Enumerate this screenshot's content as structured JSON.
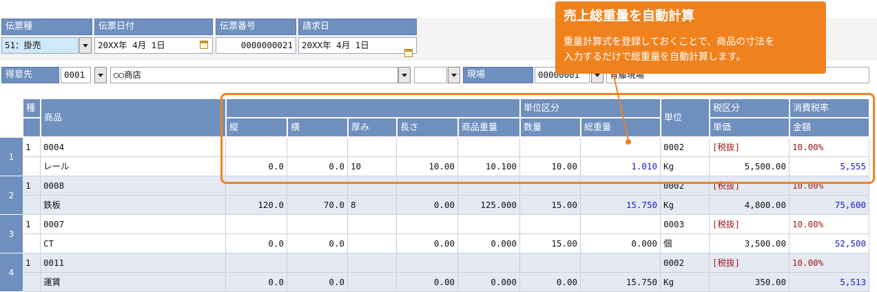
{
  "header": {
    "slip_type": {
      "label": "伝票種",
      "value": "51：掛売"
    },
    "slip_date": {
      "label": "伝票日付",
      "value": "20XX年  4月  1日"
    },
    "slip_no": {
      "label": "伝票番号",
      "value": "0000000021"
    },
    "billing_date": {
      "label": "請求日",
      "value": "20XX年  4月  1日"
    }
  },
  "customer": {
    "label": "得意先",
    "code": "0001",
    "name": "○○商店"
  },
  "site": {
    "label": "現場",
    "code": "00000001",
    "name": "青藤現場"
  },
  "table": {
    "h_type": "種",
    "h_product": "商品",
    "h_unit_group": "単位区分",
    "h_unit": "単位",
    "h_tax_class": "税区分",
    "h_tax_rate": "消費税率",
    "h_length": "縦",
    "h_width": "横",
    "h_thick": "厚み",
    "h_long": "長さ",
    "h_weight": "商品重量",
    "h_qty": "数量",
    "h_total_weight": "総重量",
    "h_price": "単価",
    "h_amount": "金額",
    "rows": [
      {
        "no": "1",
        "type": "1",
        "code": "0004",
        "name": "レール",
        "tate": "0.0",
        "yoko": "0.0",
        "thick": "10",
        "long": "10.00",
        "weight": "10.100",
        "qty": "10.00",
        "total": "1.010",
        "unit_code": "0002",
        "unit": "Kg",
        "tax": "[税抜]",
        "rate": "10.00%",
        "price": "5,500.00",
        "amount": "5,555"
      },
      {
        "no": "2",
        "type": "1",
        "code": "0008",
        "name": "鉄板",
        "tate": "120.0",
        "yoko": "70.0",
        "thick": "8",
        "long": "0.00",
        "weight": "125.000",
        "qty": "15.00",
        "total": "15.750",
        "unit_code": "0002",
        "unit": "Kg",
        "tax": "[税抜]",
        "rate": "10.00%",
        "price": "4,800.00",
        "amount": "75,600"
      },
      {
        "no": "3",
        "type": "1",
        "code": "0007",
        "name": "CT",
        "tate": "0.0",
        "yoko": "0.0",
        "thick": "",
        "long": "0.00",
        "weight": "0.000",
        "qty": "15.00",
        "total": "0.000",
        "unit_code": "0003",
        "unit": "個",
        "tax": "[税抜]",
        "rate": "10.00%",
        "price": "3,500.00",
        "amount": "52,500"
      },
      {
        "no": "4",
        "type": "1",
        "code": "0011",
        "name": "運賃",
        "tate": "0.0",
        "yoko": "0.0",
        "thick": "",
        "long": "0.00",
        "weight": "0.000",
        "qty": "0.00",
        "total": "15.750",
        "unit_code": "0002",
        "unit": "Kg",
        "tax": "[税抜]",
        "rate": "10.00%",
        "price": "350.00",
        "amount": "5,513"
      }
    ]
  },
  "callout": {
    "title": "売上総重量を自動計算",
    "body1": "重量計算式を登録しておくことで、商品の寸法を",
    "body2": "入力するだけで総重量を自動計算します。"
  },
  "colors": {
    "header_bg": "#6f8fbf",
    "accent_orange": "#f0821e",
    "tax_red": "#a01818",
    "amount_blue": "#1a1ac8"
  }
}
